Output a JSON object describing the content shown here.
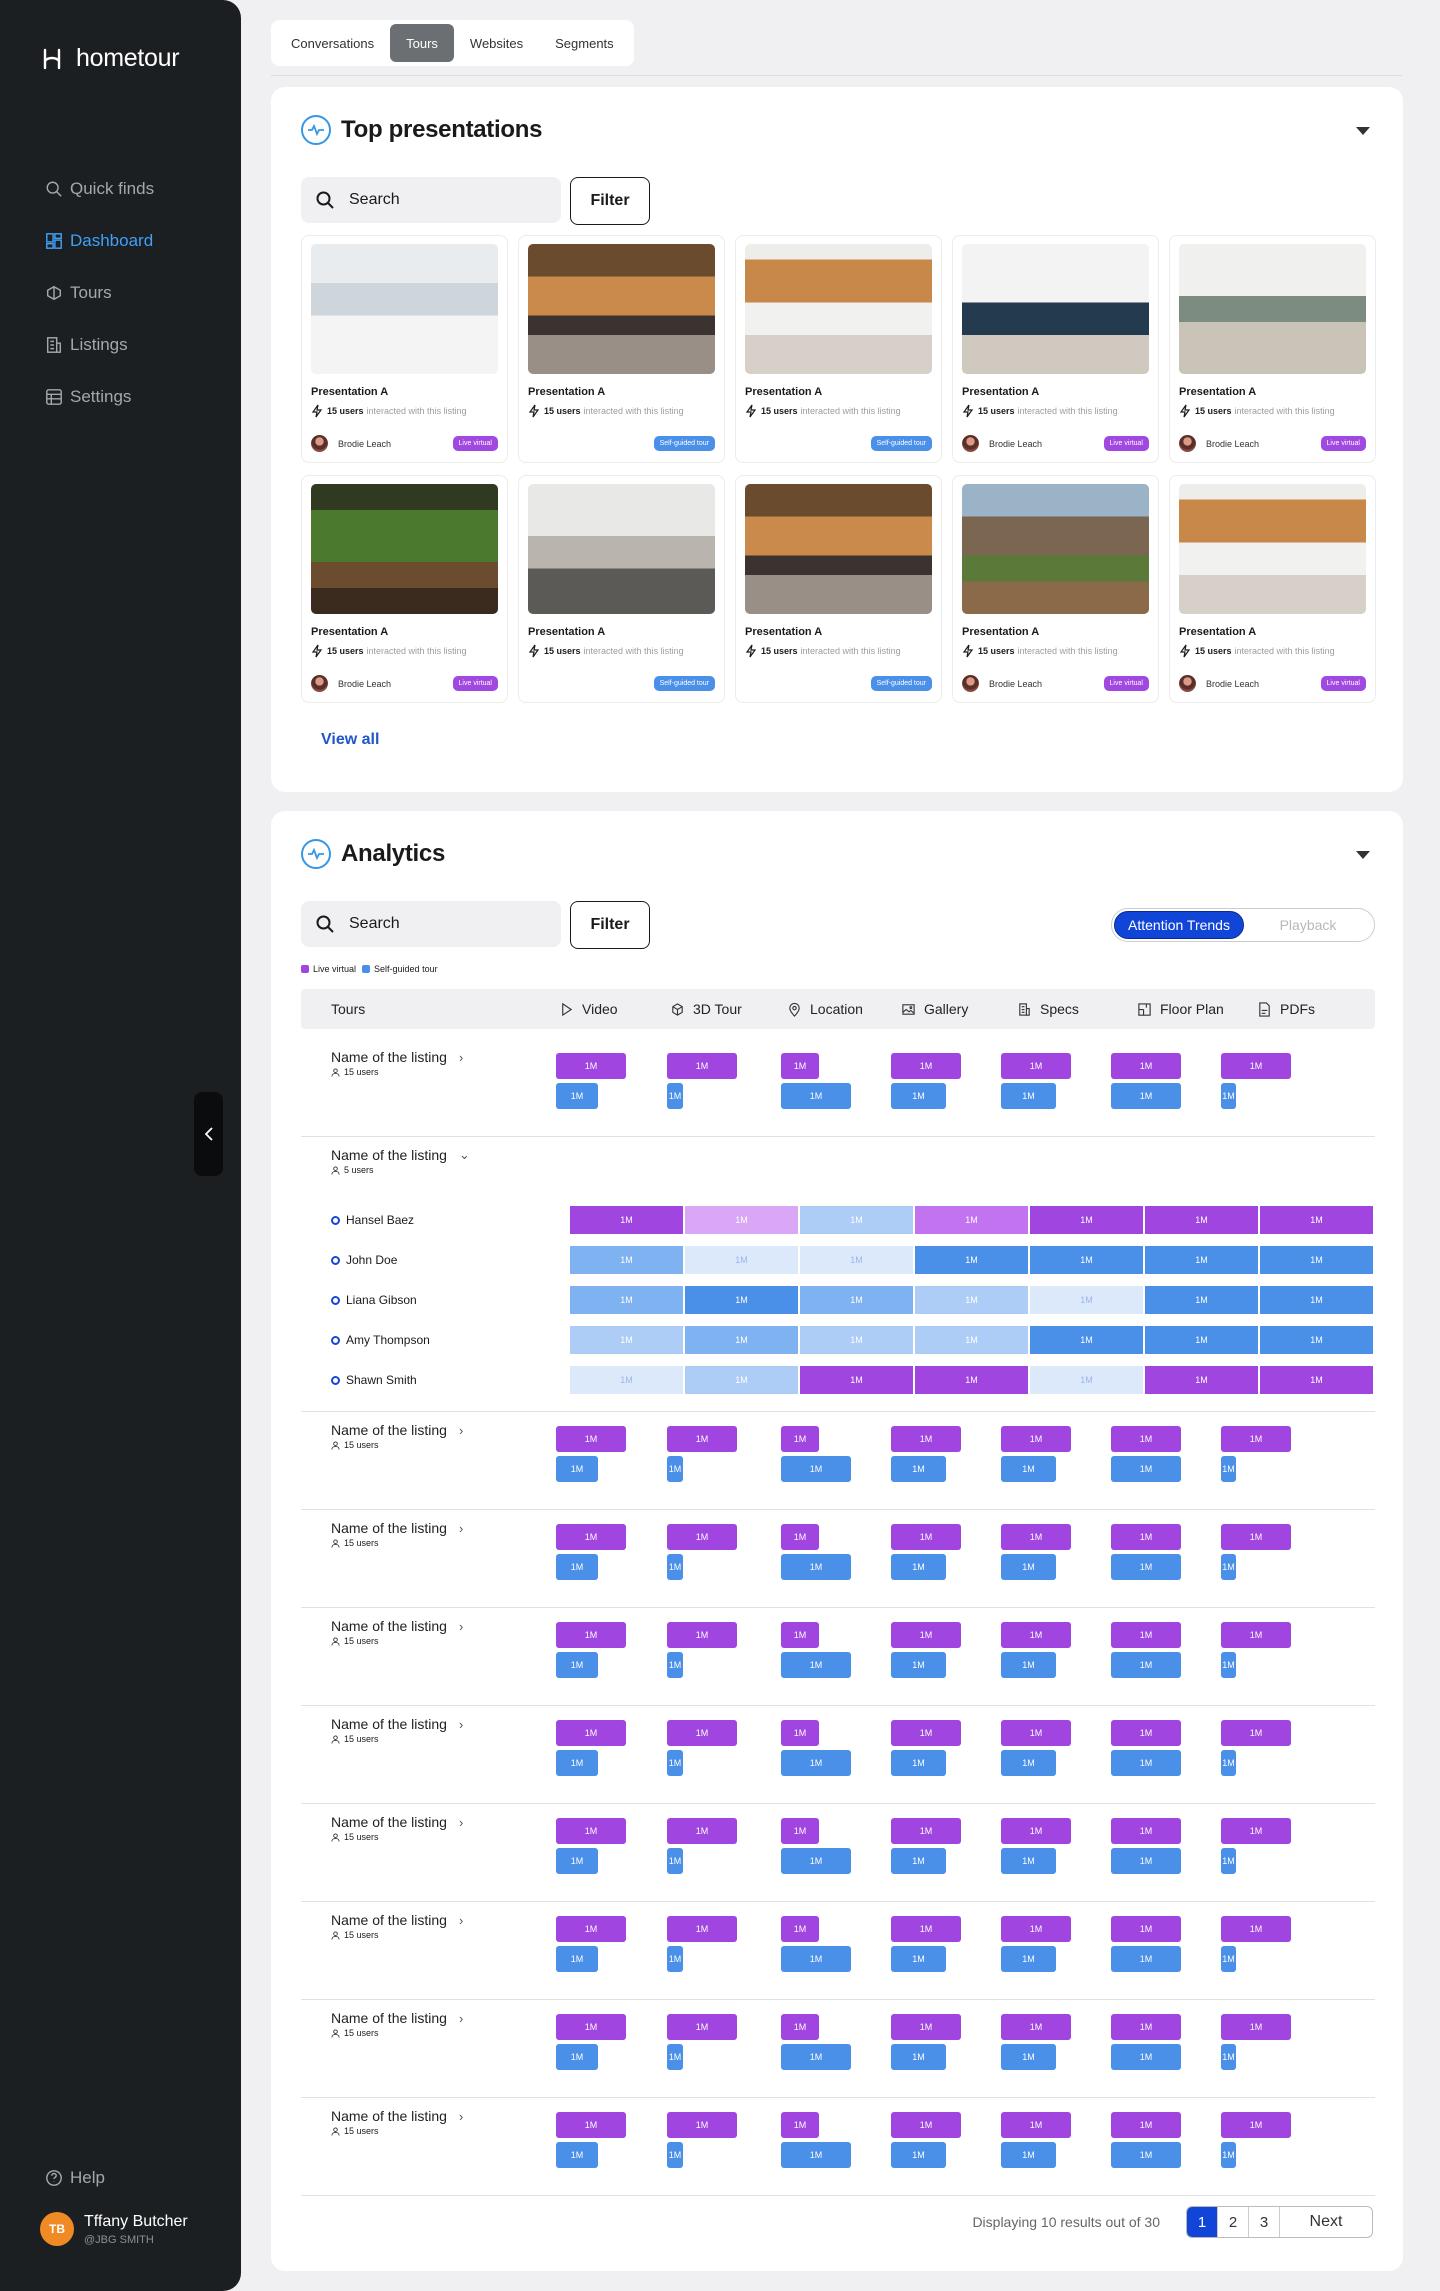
{
  "app": {
    "name": "hometour"
  },
  "sidebar": {
    "items": [
      {
        "label": "Quick finds",
        "icon": "search-icon"
      },
      {
        "label": "Dashboard",
        "icon": "dashboard-icon"
      },
      {
        "label": "Tours",
        "icon": "tours-icon"
      },
      {
        "label": "Listings",
        "icon": "building-icon"
      },
      {
        "label": "Settings",
        "icon": "settings-icon"
      }
    ],
    "active": "Dashboard",
    "help": "Help",
    "user": {
      "initials": "TB",
      "name": "Tffany Butcher",
      "handle": "@JBG SMITH"
    }
  },
  "tabs": [
    "Conversations",
    "Tours",
    "Websites",
    "Segments"
  ],
  "active_tab": "Tours",
  "presentations": {
    "title": "Top presentations",
    "search_placeholder": "Search",
    "filter_label": "Filter",
    "view_all": "View all",
    "cards": [
      {
        "name": "Presentation A",
        "users": "15 users",
        "note": "interacted with this listing",
        "agent": "Brodie Leach",
        "tag": "Live virtual"
      },
      {
        "name": "Presentation A",
        "users": "15 users",
        "note": "interacted with this listing",
        "agent": "",
        "tag": "Self-guided tour"
      },
      {
        "name": "Presentation A",
        "users": "15 users",
        "note": "interacted with this listing",
        "agent": "",
        "tag": "Self-guided tour"
      },
      {
        "name": "Presentation A",
        "users": "15 users",
        "note": "interacted with this listing",
        "agent": "Brodie Leach",
        "tag": "Live virtual"
      },
      {
        "name": "Presentation A",
        "users": "15 users",
        "note": "interacted with this listing",
        "agent": "Brodie Leach",
        "tag": "Live virtual"
      },
      {
        "name": "Presentation A",
        "users": "15 users",
        "note": "interacted with this listing",
        "agent": "Brodie Leach",
        "tag": "Live virtual"
      },
      {
        "name": "Presentation A",
        "users": "15 users",
        "note": "interacted with this listing",
        "agent": "",
        "tag": "Self-guided tour"
      },
      {
        "name": "Presentation A",
        "users": "15 users",
        "note": "interacted with this listing",
        "agent": "",
        "tag": "Self-guided tour"
      },
      {
        "name": "Presentation A",
        "users": "15 users",
        "note": "interacted with this listing",
        "agent": "Brodie Leach",
        "tag": "Live virtual"
      },
      {
        "name": "Presentation A",
        "users": "15 users",
        "note": "interacted with this listing",
        "agent": "Brodie Leach",
        "tag": "Live virtual"
      }
    ]
  },
  "analytics": {
    "title": "Analytics",
    "search_placeholder": "Search",
    "filter_label": "Filter",
    "toggle": [
      "Attention Trends",
      "Playback"
    ],
    "legend": [
      {
        "label": "Live virtual",
        "color": "#a045e0"
      },
      {
        "label": "Self-guided tour",
        "color": "#4a90e8"
      }
    ],
    "columns": [
      {
        "label": "Tours",
        "icon": ""
      },
      {
        "label": "Video",
        "icon": "play-icon"
      },
      {
        "label": "3D Tour",
        "icon": "cube-icon"
      },
      {
        "label": "Location",
        "icon": "pin-icon"
      },
      {
        "label": "Gallery",
        "icon": "image-icon"
      },
      {
        "label": "Specs",
        "icon": "building-icon"
      },
      {
        "label": "Floor Plan",
        "icon": "floorplan-icon"
      },
      {
        "label": "PDFs",
        "icon": "pdf-icon"
      }
    ],
    "bar_label": "1M",
    "rows": [
      {
        "name": "Name of the listing",
        "users": "15 users",
        "expanded": false
      },
      {
        "name": "Name of the listing",
        "users": "5 users",
        "expanded": true,
        "people": [
          {
            "name": "Hansel Baez",
            "cells": [
              "p",
              "p3",
              "b3",
              "p2",
              "p",
              "p",
              "p"
            ]
          },
          {
            "name": "John Doe",
            "cells": [
              "b2",
              "b4",
              "b4",
              "b",
              "b",
              "b",
              "b"
            ]
          },
          {
            "name": "Liana Gibson",
            "cells": [
              "b2",
              "b",
              "b2",
              "b3",
              "b4",
              "b",
              "b"
            ]
          },
          {
            "name": "Amy Thompson",
            "cells": [
              "b3",
              "b2",
              "b3",
              "b3",
              "b",
              "b",
              "b"
            ]
          },
          {
            "name": "Shawn Smith",
            "cells": [
              "b4",
              "b3",
              "p",
              "p",
              "b4",
              "p",
              "p"
            ]
          }
        ]
      },
      {
        "name": "Name of the listing",
        "users": "15 users",
        "expanded": false
      },
      {
        "name": "Name of the listing",
        "users": "15 users",
        "expanded": false
      },
      {
        "name": "Name of the listing",
        "users": "15 users",
        "expanded": false
      },
      {
        "name": "Name of the listing",
        "users": "15 users",
        "expanded": false
      },
      {
        "name": "Name of the listing",
        "users": "15 users",
        "expanded": false
      },
      {
        "name": "Name of the listing",
        "users": "15 users",
        "expanded": false
      },
      {
        "name": "Name of the listing",
        "users": "15 users",
        "expanded": false
      },
      {
        "name": "Name of the listing",
        "users": "15 users",
        "expanded": false
      }
    ],
    "pagination": {
      "text": "Displaying 10 results out of 30",
      "pages": [
        "1",
        "2",
        "3"
      ],
      "current": "1",
      "next": "Next"
    }
  }
}
